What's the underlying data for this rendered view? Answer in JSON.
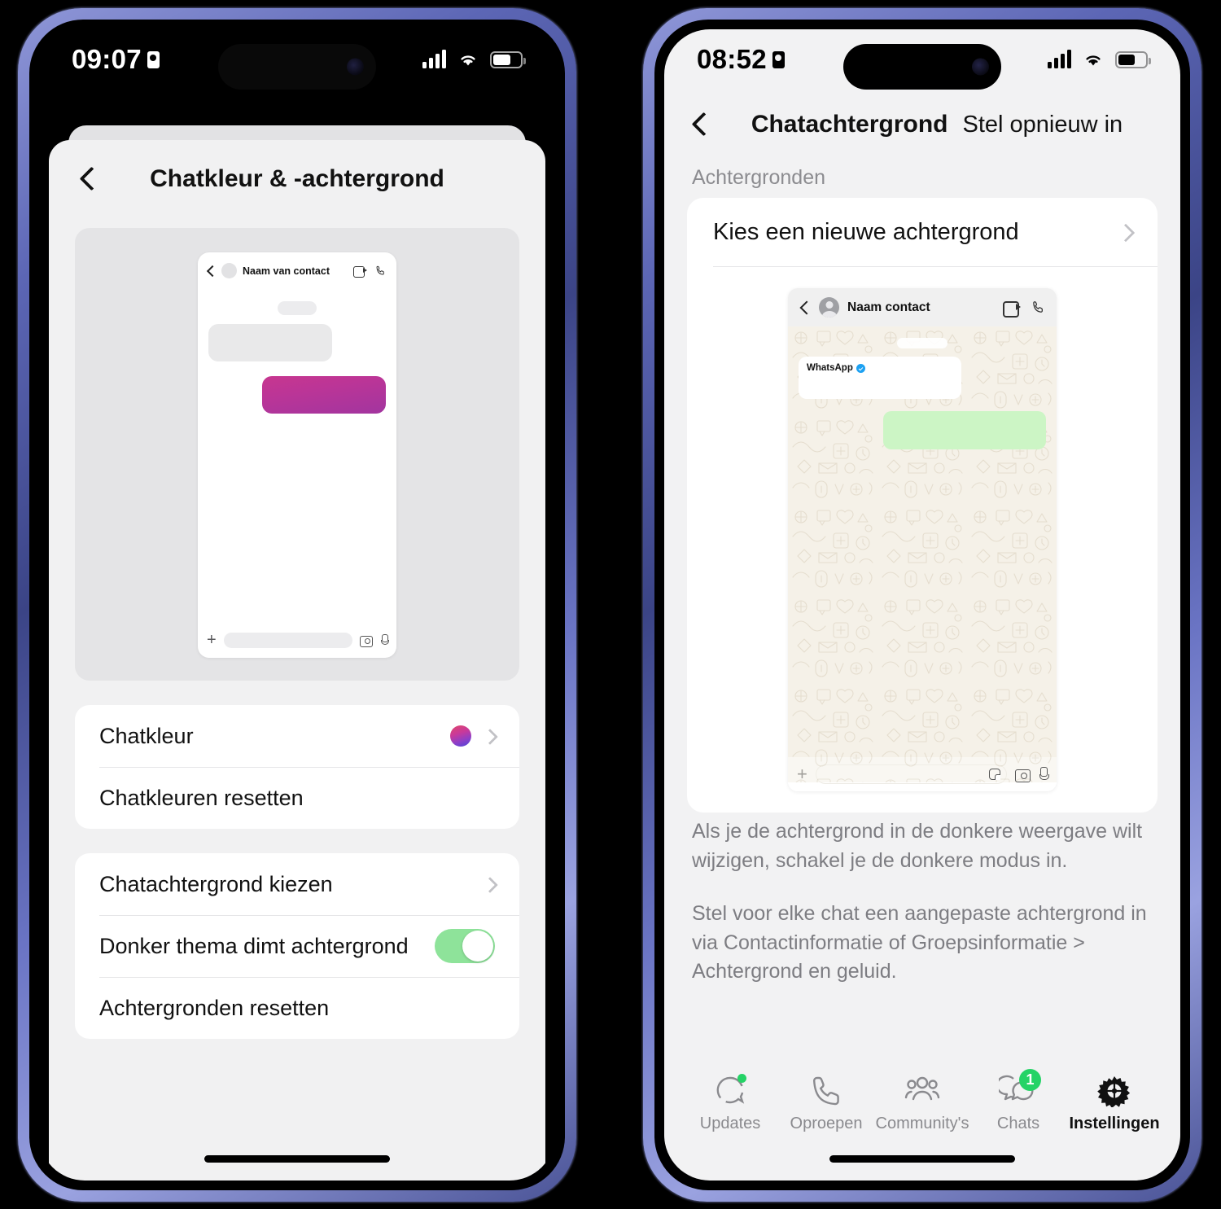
{
  "left_phone": {
    "status": {
      "time": "09:07",
      "lock_icon": "id-card-icon"
    },
    "nav": {
      "back": "back-chevron",
      "title": "Chatkleur & -achtergrond"
    },
    "preview": {
      "contact_name": "Naam van contact",
      "icons": [
        "video-call-icon",
        "voice-call-icon"
      ],
      "composer": {
        "plus": "+",
        "camera": "camera-icon",
        "mic": "microphone-icon"
      }
    },
    "groups": [
      {
        "rows": [
          {
            "label": "Chatkleur",
            "accessory": "color-swatch",
            "chevron": true
          },
          {
            "label": "Chatkleuren resetten",
            "accessory": "none",
            "chevron": false
          }
        ]
      },
      {
        "rows": [
          {
            "label": "Chatachtergrond kiezen",
            "accessory": "none",
            "chevron": true
          },
          {
            "label": "Donker thema dimt achtergrond",
            "accessory": "toggle-on",
            "chevron": false
          },
          {
            "label": "Achtergronden resetten",
            "accessory": "none",
            "chevron": false
          }
        ]
      }
    ],
    "colors": {
      "swatch_gradient_start": "#e0486b",
      "swatch_gradient_end": "#4a45d6",
      "bubble_out": "#bb3597",
      "toggle_on": "#8ee39a"
    }
  },
  "right_phone": {
    "status": {
      "time": "08:52",
      "lock_icon": "id-card-icon"
    },
    "nav": {
      "back": "back-chevron",
      "title": "Chatachtergrond",
      "action": "Stel opnieuw in"
    },
    "section_label": "Achtergronden",
    "choose_row": {
      "label": "Kies een nieuwe achtergrond",
      "chevron": true
    },
    "preview": {
      "contact_name": "Naam contact",
      "bubble_in_title": "WhatsApp",
      "verified": true,
      "icons": [
        "video-call-icon",
        "voice-call-icon"
      ],
      "composer": {
        "plus": "+",
        "sticker": "sticker-icon",
        "camera": "camera-icon",
        "mic": "microphone-icon"
      }
    },
    "notes": [
      "Als je de achtergrond in de donkere weergave wilt wijzigen, schakel je de donkere modus in.",
      "Stel voor elke chat een aangepaste achtergrond in via Contactinformatie of Groepsinformatie > Achtergrond en geluid."
    ],
    "tabs": [
      {
        "label": "Updates",
        "icon": "updates-icon",
        "active": false,
        "dot": true,
        "badge": ""
      },
      {
        "label": "Oproepen",
        "icon": "calls-icon",
        "active": false,
        "dot": false,
        "badge": ""
      },
      {
        "label": "Community's",
        "icon": "communities-icon",
        "active": false,
        "dot": false,
        "badge": ""
      },
      {
        "label": "Chats",
        "icon": "chats-icon",
        "active": false,
        "dot": false,
        "badge": "1"
      },
      {
        "label": "Instellingen",
        "icon": "settings-gear-icon",
        "active": true,
        "dot": false,
        "badge": ""
      }
    ],
    "colors": {
      "bubble_out": "#ccf5c5",
      "wallpaper": "#f5f1e8",
      "accent_green": "#25d366",
      "verified_blue": "#1da1f2"
    }
  }
}
